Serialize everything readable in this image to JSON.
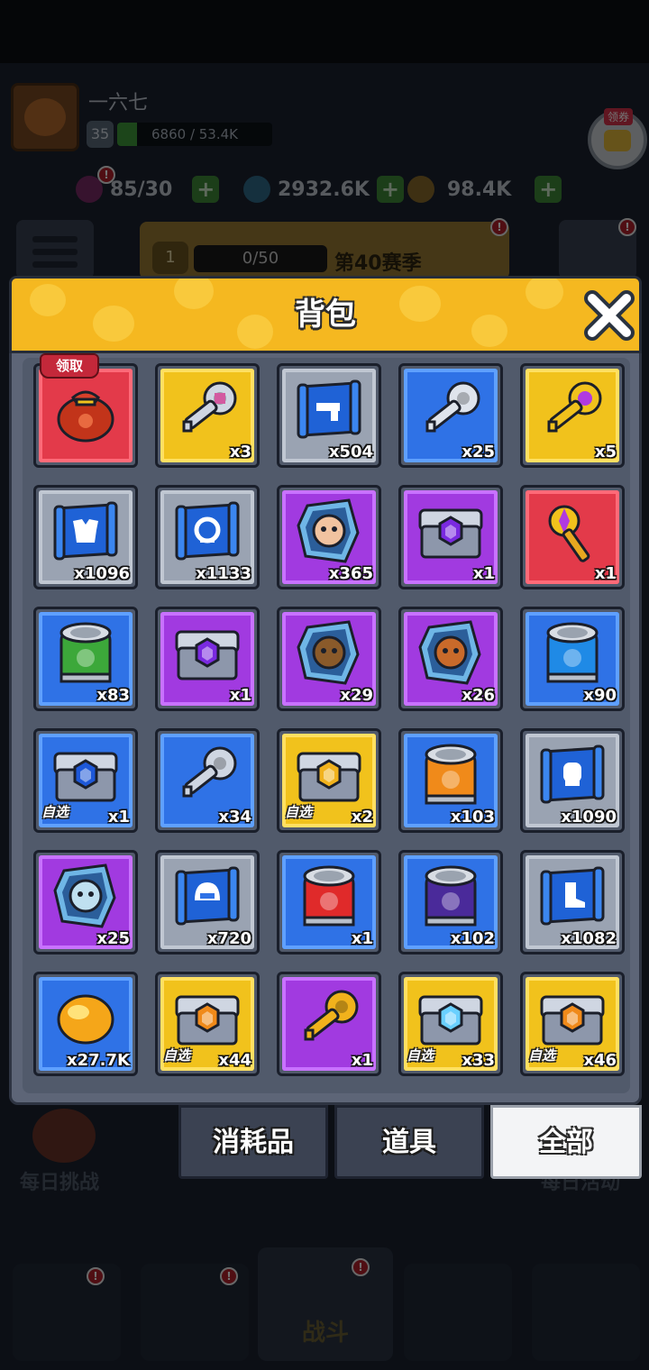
{
  "background": {
    "player": {
      "name": "一六七",
      "level": "35",
      "exp_text": "6860 / 53.4K",
      "exp_progress": 0.13
    },
    "coupon_label": "领券",
    "resources": [
      {
        "icon": "energy-icon",
        "value": "85/30"
      },
      {
        "icon": "diamond-icon",
        "value": "2932.6K"
      },
      {
        "icon": "gold-coin-icon",
        "value": "98.4K"
      }
    ],
    "season": {
      "level": "1",
      "progress": "0/50",
      "name": "第40赛季"
    },
    "daily_challenge_label": "每日挑战",
    "daily_activity_label": "每日活动",
    "battle_label": "战斗"
  },
  "backpack": {
    "title": "背包",
    "claim_label": "领取",
    "select_label": "自选",
    "items": [
      {
        "rarity": "red",
        "icon": "lucky-bag-icon",
        "qty": "",
        "claim": true
      },
      {
        "rarity": "gold",
        "icon": "silver-key-icon",
        "qty": "x3"
      },
      {
        "rarity": "gray",
        "icon": "gun-blueprint-icon",
        "qty": "x504"
      },
      {
        "rarity": "blue",
        "icon": "ring-key-icon",
        "qty": "x25"
      },
      {
        "rarity": "gold",
        "icon": "purple-gem-key-icon",
        "qty": "x5"
      },
      {
        "rarity": "gray",
        "icon": "armor-blueprint-icon",
        "qty": "x1096"
      },
      {
        "rarity": "gray",
        "icon": "ring-blueprint-icon",
        "qty": "x1133"
      },
      {
        "rarity": "purple",
        "icon": "hero-shard-boy-icon",
        "qty": "x365"
      },
      {
        "rarity": "purple",
        "icon": "purple-chest-icon",
        "qty": "x1"
      },
      {
        "rarity": "red",
        "icon": "golden-scepter-key-icon",
        "qty": "x1"
      },
      {
        "rarity": "blue",
        "icon": "green-can-icon",
        "qty": "x83"
      },
      {
        "rarity": "purple",
        "icon": "purple-shield-chest-icon",
        "qty": "x1"
      },
      {
        "rarity": "purple",
        "icon": "hero-shard-tree-icon",
        "qty": "x29"
      },
      {
        "rarity": "purple",
        "icon": "hero-shard-raccoon-icon",
        "qty": "x26"
      },
      {
        "rarity": "blue",
        "icon": "blue-water-can-icon",
        "qty": "x90"
      },
      {
        "rarity": "blue",
        "icon": "blue-chest-icon",
        "qty": "x1",
        "select": true
      },
      {
        "rarity": "blue",
        "icon": "steel-key-icon",
        "qty": "x34"
      },
      {
        "rarity": "gold",
        "icon": "gold-chest-icon",
        "qty": "x2",
        "select": true
      },
      {
        "rarity": "blue",
        "icon": "orange-star-can-icon",
        "qty": "x103"
      },
      {
        "rarity": "gray",
        "icon": "glove-blueprint-icon",
        "qty": "x1090"
      },
      {
        "rarity": "purple",
        "icon": "hero-shard-ghost-icon",
        "qty": "x25"
      },
      {
        "rarity": "gray",
        "icon": "helmet-blueprint-icon",
        "qty": "x720"
      },
      {
        "rarity": "blue",
        "icon": "red-fire-can-icon",
        "qty": "x1"
      },
      {
        "rarity": "blue",
        "icon": "purple-moon-can-icon",
        "qty": "x102"
      },
      {
        "rarity": "gray",
        "icon": "boot-blueprint-icon",
        "qty": "x1082"
      },
      {
        "rarity": "blue",
        "icon": "gold-nugget-icon",
        "qty": "x27.7K"
      },
      {
        "rarity": "gold",
        "icon": "orange-gem-chest-icon",
        "qty": "x44",
        "select": true
      },
      {
        "rarity": "purple",
        "icon": "gold-key-icon",
        "qty": "x1"
      },
      {
        "rarity": "gold",
        "icon": "crystal-chest-icon",
        "qty": "x33",
        "select": true
      },
      {
        "rarity": "gold",
        "icon": "hex-gem-chest-icon",
        "qty": "x46",
        "select": true
      }
    ]
  },
  "tabs": [
    {
      "label": "消耗品",
      "active": false
    },
    {
      "label": "道具",
      "active": false
    },
    {
      "label": "全部",
      "active": true
    }
  ]
}
